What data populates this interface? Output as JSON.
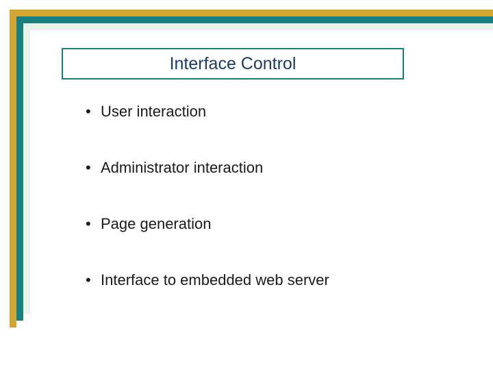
{
  "title": "Interface Control",
  "bullets": [
    "User interaction",
    "Administrator interaction",
    "Page generation",
    "Interface to embedded web server"
  ],
  "colors": {
    "frame_outer": "#d4a531",
    "frame_mid": "#1a7e7e",
    "frame_inner": "#e8f2e8",
    "title_text": "#1a3a6e"
  }
}
